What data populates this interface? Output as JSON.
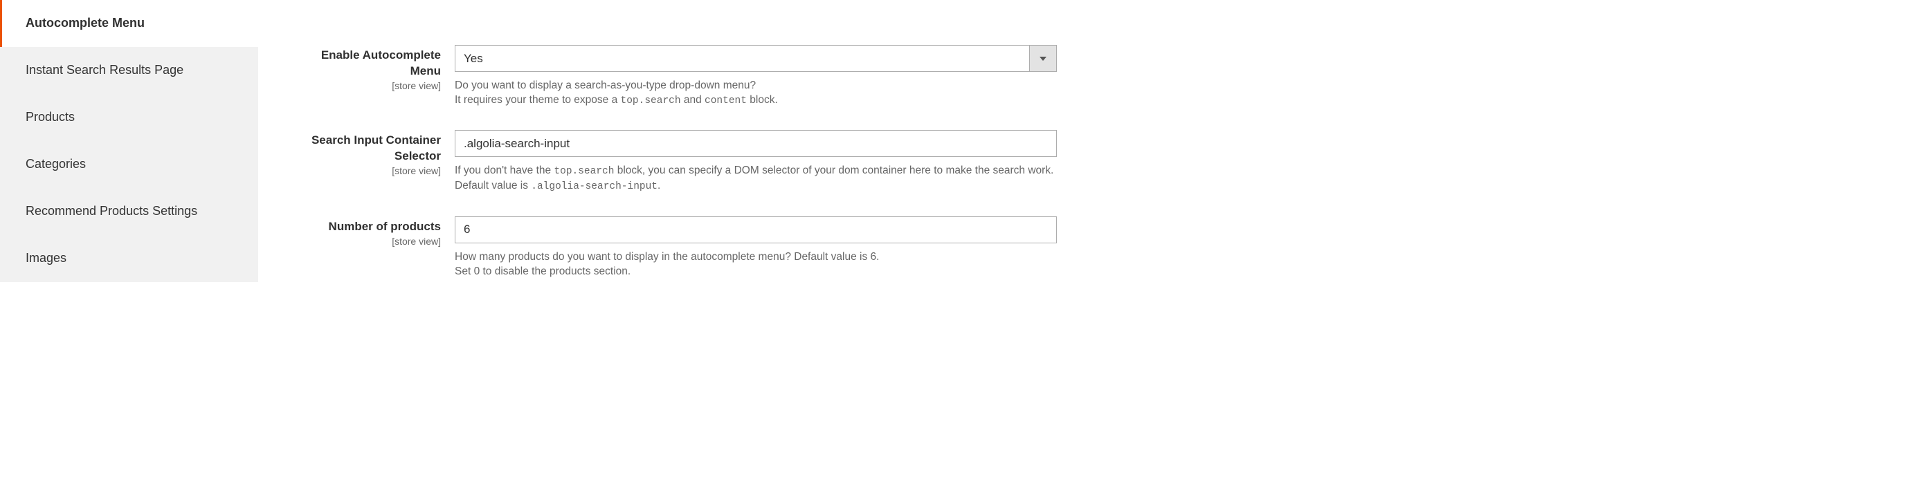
{
  "sidebar": {
    "items": [
      {
        "label": "Autocomplete Menu"
      },
      {
        "label": "Instant Search Results Page"
      },
      {
        "label": "Products"
      },
      {
        "label": "Categories"
      },
      {
        "label": "Recommend Products Settings"
      },
      {
        "label": "Images"
      }
    ]
  },
  "fields": {
    "enable": {
      "label": "Enable Autocomplete Menu",
      "scope": "[store view]",
      "value": "Yes",
      "help1": "Do you want to display a search-as-you-type drop-down menu?",
      "help2a": "It requires your theme to expose a ",
      "help2code1": "top.search",
      "help2b": " and ",
      "help2code2": "content",
      "help2c": " block."
    },
    "selector": {
      "label": "Search Input Container Selector",
      "scope": "[store view]",
      "value": ".algolia-search-input",
      "help1a": "If you don't have the ",
      "help1code1": "top.search",
      "help1b": " block, you can specify a DOM selector of your dom container here to make the search work. Default value is ",
      "help1code2": ".algolia-search-input",
      "help1c": "."
    },
    "num": {
      "label": "Number of products",
      "scope": "[store view]",
      "value": "6",
      "help1": "How many products do you want to display in the autocomplete menu? Default value is 6.",
      "help2": "Set 0 to disable the products section."
    }
  }
}
